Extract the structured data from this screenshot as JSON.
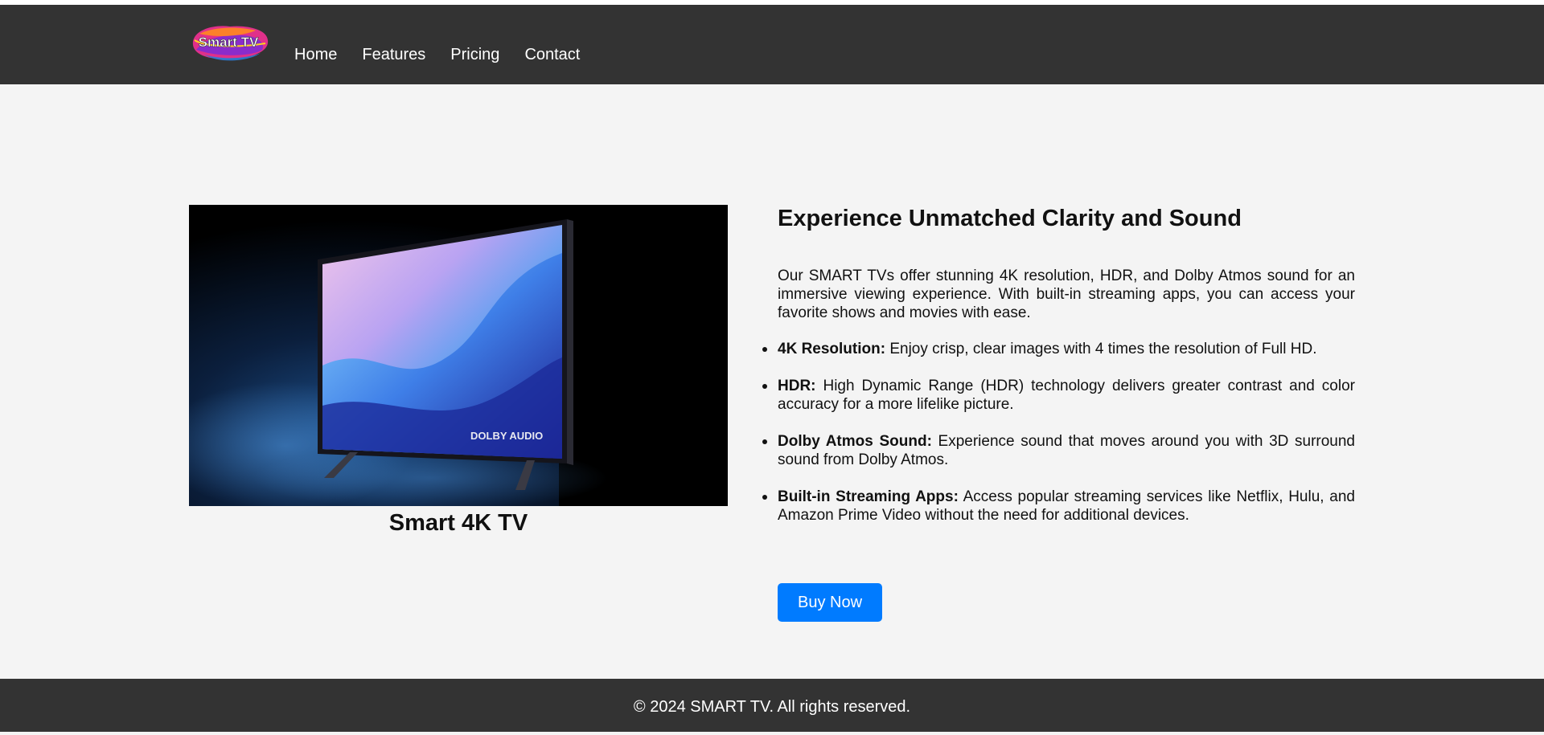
{
  "header": {
    "logo_text": "Smart TV",
    "nav": [
      {
        "label": "Home"
      },
      {
        "label": "Features"
      },
      {
        "label": "Pricing"
      },
      {
        "label": "Contact"
      }
    ]
  },
  "hero": {
    "image_label": "smart-tv-product-image",
    "screen_badge": "DOLBY AUDIO",
    "product_name": "Smart 4K TV"
  },
  "content": {
    "title": "Experience Unmatched Clarity and Sound",
    "intro": "Our SMART TVs offer stunning 4K resolution, HDR, and Dolby Atmos sound for an immersive viewing experience. With built-in streaming apps, you can access your favorite shows and movies with ease.",
    "features": [
      {
        "name": "4K Resolution:",
        "text": " Enjoy crisp, clear images with 4 times the resolution of Full HD."
      },
      {
        "name": "HDR:",
        "text": " High Dynamic Range (HDR) technology delivers greater contrast and color accuracy for a more lifelike picture."
      },
      {
        "name": "Dolby Atmos Sound:",
        "text": " Experience sound that moves around you with 3D surround sound from Dolby Atmos."
      },
      {
        "name": "Built-in Streaming Apps:",
        "text": " Access popular streaming services like Netflix, Hulu, and Amazon Prime Video without the need for additional devices."
      }
    ],
    "buy_label": "Buy Now"
  },
  "footer": {
    "copyright": "© 2024 SMART TV. All rights reserved."
  },
  "colors": {
    "header_bg": "#333333",
    "page_bg": "#f4f4f4",
    "accent": "#007bff",
    "footer_bg": "#333333"
  }
}
